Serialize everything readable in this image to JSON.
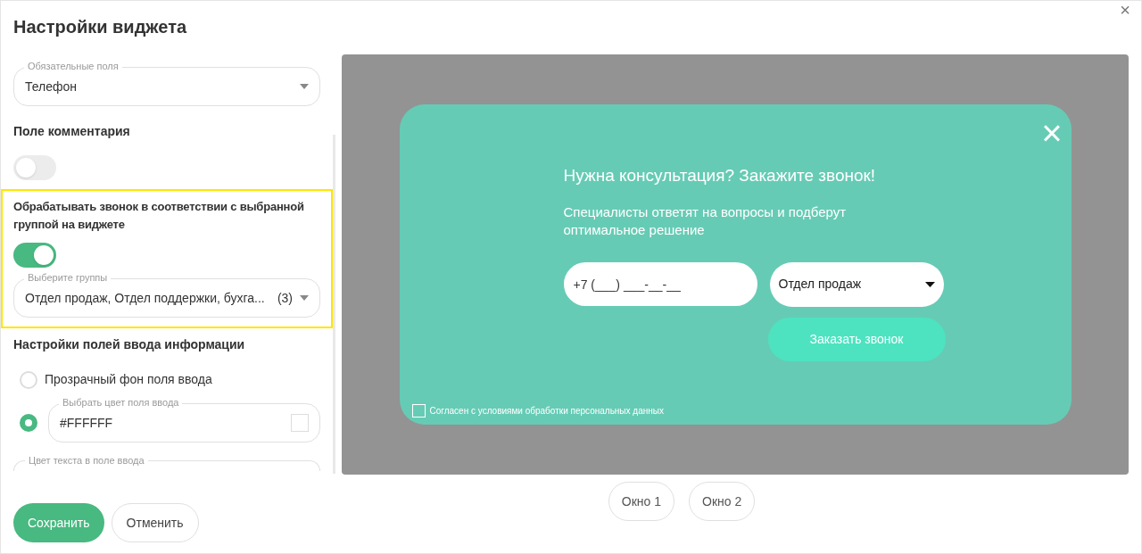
{
  "window": {
    "title": "Настройки виджета",
    "close": "×"
  },
  "settings": {
    "required_fields": {
      "label": "Обязательные поля",
      "value": "Телефон"
    },
    "comment_field": {
      "label": "Поле комментария",
      "on": false
    },
    "group_routing": {
      "label": "Обрабатывать звонок в соответствии с выбранной группой на виджете",
      "on": true,
      "highlighted": true,
      "groups": {
        "label": "Выберите группы",
        "value": "Отдел продаж, Отдел поддержки, бухга...",
        "count": "(3)"
      }
    },
    "input_settings": {
      "title": "Настройки полей ввода информации",
      "options": [
        {
          "kind": "radio",
          "label": "Прозрачный фон поля ввода",
          "selected": false
        },
        {
          "kind": "color",
          "label": "Выбрать цвет поля ввода",
          "value": "#FFFFFF",
          "selected": true
        }
      ]
    },
    "text_color": {
      "label": "Цвет текста в поле ввода"
    }
  },
  "buttons": [
    {
      "label": "Сохранить",
      "primary": true
    },
    {
      "label": "Отменить",
      "primary": false
    }
  ],
  "preview": {
    "widget": {
      "close": "×",
      "title": "Нужна консультация? Закажите звонок!",
      "subtitle": "Специалисты ответят на вопросы и подберут оптимальное решение",
      "phone_placeholder": "+7 (___) ___-__-__",
      "group": "Отдел продаж",
      "submit": "Заказать звонок",
      "consent": {
        "label": "Согласен с условиями обработки персональных данных",
        "checked": false
      }
    },
    "windows": [
      {
        "label": "Окно 1",
        "selected": false
      },
      {
        "label": "Окно 2",
        "selected": false
      }
    ]
  }
}
